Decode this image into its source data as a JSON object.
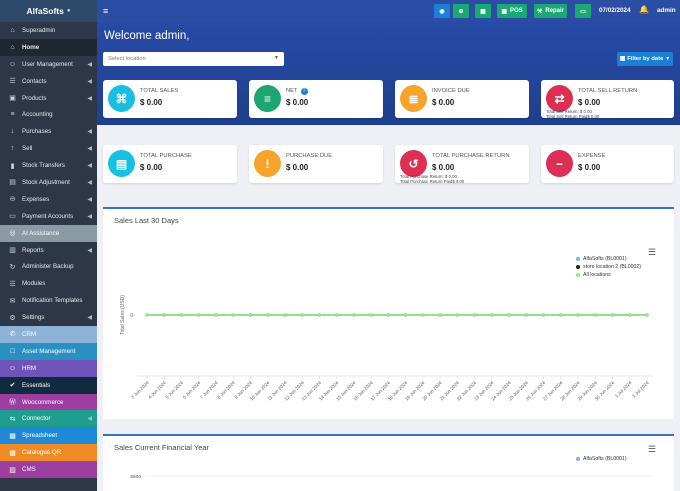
{
  "brand": {
    "name": "AlfaSofts",
    "tag": "●"
  },
  "sidebar": {
    "items": [
      {
        "label": "Superadmin",
        "icon": "home-icon",
        "bg": "",
        "arrow": false,
        "active": false
      },
      {
        "label": "Home",
        "icon": "home-icon",
        "bg": "",
        "arrow": false,
        "active": true
      },
      {
        "label": "User Management",
        "icon": "users-icon",
        "bg": "",
        "arrow": true,
        "active": false
      },
      {
        "label": "Contacts",
        "icon": "address-book-icon",
        "bg": "",
        "arrow": true,
        "active": false
      },
      {
        "label": "Products",
        "icon": "cube-icon",
        "bg": "",
        "arrow": true,
        "active": false
      },
      {
        "label": "Accounting",
        "icon": "accounting-icon",
        "bg": "",
        "arrow": false,
        "active": false
      },
      {
        "label": "Purchases",
        "icon": "download-icon",
        "bg": "",
        "arrow": true,
        "active": false
      },
      {
        "label": "Sell",
        "icon": "upload-icon",
        "bg": "",
        "arrow": true,
        "active": false
      },
      {
        "label": "Stock Transfers",
        "icon": "truck-icon",
        "bg": "",
        "arrow": true,
        "active": false
      },
      {
        "label": "Stock Adjustment",
        "icon": "database-icon",
        "bg": "",
        "arrow": true,
        "active": false
      },
      {
        "label": "Expenses",
        "icon": "minus-circle-icon",
        "bg": "",
        "arrow": true,
        "active": false
      },
      {
        "label": "Payment Accounts",
        "icon": "money-icon",
        "bg": "",
        "arrow": true,
        "active": false
      },
      {
        "label": "AI Assistance",
        "icon": "robot-icon",
        "bg": "#8a9ba6",
        "arrow": false,
        "active": false
      },
      {
        "label": "Reports",
        "icon": "chart-icon",
        "bg": "",
        "arrow": true,
        "active": false
      },
      {
        "label": "Administer Backup",
        "icon": "backup-icon",
        "bg": "",
        "arrow": false,
        "active": false
      },
      {
        "label": "Modules",
        "icon": "plug-icon",
        "bg": "",
        "arrow": false,
        "active": false
      },
      {
        "label": "Notification Templates",
        "icon": "envelope-icon",
        "bg": "",
        "arrow": false,
        "active": false
      },
      {
        "label": "Settings",
        "icon": "gear-icon",
        "bg": "",
        "arrow": true,
        "active": false
      },
      {
        "label": "CRM",
        "icon": "crm-icon",
        "bg": "#8db3d8",
        "arrow": false,
        "active": false
      },
      {
        "label": "Asset Management",
        "icon": "box-icon",
        "bg": "#2a8fc2",
        "arrow": false,
        "active": false
      },
      {
        "label": "HRM",
        "icon": "users-icon",
        "bg": "#6f53b8",
        "arrow": false,
        "active": false
      },
      {
        "label": "Essentials",
        "icon": "check-circle-icon",
        "bg": "#102a3f",
        "arrow": false,
        "active": false
      },
      {
        "label": "Woocommerce",
        "icon": "wordpress-icon",
        "bg": "#9c3d9f",
        "arrow": false,
        "active": false
      },
      {
        "label": "Connector",
        "icon": "connector-icon",
        "bg": "#1f9e8f",
        "arrow": true,
        "active": false
      },
      {
        "label": "Spreadsheet",
        "icon": "sheet-icon",
        "bg": "#1e8ad7",
        "arrow": false,
        "active": false
      },
      {
        "label": "Catalogue QR",
        "icon": "qrcode-icon",
        "bg": "#f08a24",
        "arrow": false,
        "active": false
      },
      {
        "label": "CMS",
        "icon": "cms-icon",
        "bg": "#9c3d9f",
        "arrow": false,
        "active": false
      }
    ]
  },
  "topbar": {
    "menu_icon": "≡",
    "buttons": [
      {
        "label": "",
        "icon": "circle-down-icon",
        "glyph": "◉",
        "color": "#1c7fd6"
      },
      {
        "label": "",
        "icon": "plus-circle-icon",
        "glyph": "⊕",
        "color": "#19a974"
      },
      {
        "label": "",
        "icon": "calculator-icon",
        "glyph": "▦",
        "color": "#19a974"
      },
      {
        "label": "POS",
        "icon": "grid-icon",
        "glyph": "▦",
        "color": "#19a974"
      },
      {
        "label": "Repair",
        "icon": "wrench-icon",
        "glyph": "⚒",
        "color": "#19a974"
      },
      {
        "label": "",
        "icon": "money-icon",
        "glyph": "▭",
        "color": "#19a974"
      }
    ],
    "date": "07/02/2024",
    "user": "admin"
  },
  "header": {
    "welcome": "Welcome admin,",
    "location_placeholder": "Select location",
    "filter_label": "Filter by date"
  },
  "stats_row1": [
    {
      "label": "TOTAL SALES",
      "value": "$ 0.00",
      "color": "#17c0e3",
      "icon": "cart-icon",
      "glyph": "⌘",
      "subs": []
    },
    {
      "label": "NET",
      "value": "$ 0.00",
      "color": "#1ca672",
      "icon": "list-icon",
      "glyph": "≡",
      "subs": [],
      "info": "i"
    },
    {
      "label": "INVOICE DUE",
      "value": "$ 0.00",
      "color": "#f6a42c",
      "icon": "invoice-icon",
      "glyph": "≣",
      "subs": []
    },
    {
      "label": "TOTAL SELL RETURN",
      "value": "$ 0.00",
      "color": "#dc2f53",
      "icon": "exchange-icon",
      "glyph": "⇄",
      "subs": [
        "Total Sell Return: $ 0.00",
        "Total Sell Return Paid$ 0.00"
      ]
    }
  ],
  "stats_row2": [
    {
      "label": "TOTAL PURCHASE",
      "value": "$ 0.00",
      "color": "#17c0e3",
      "icon": "money-icon",
      "glyph": "▤",
      "subs": []
    },
    {
      "label": "PURCHASE DUE",
      "value": "$ 0.00",
      "color": "#f6a42c",
      "icon": "warning-icon",
      "glyph": "!",
      "subs": []
    },
    {
      "label": "TOTAL PURCHASE RETURN",
      "value": "$ 0.00",
      "color": "#dc2f53",
      "icon": "undo-icon",
      "glyph": "↺",
      "subs": [
        "Total Purchase Return: $ 0.00",
        "Total Purchase Return Paid$ 0.00"
      ]
    },
    {
      "label": "EXPENSE",
      "value": "$ 0.00",
      "color": "#dc2f53",
      "icon": "minus-circle-icon",
      "glyph": "−",
      "subs": []
    }
  ],
  "chart1_title": "Sales Last 30 Days",
  "chart2_title": "Sales Current Financial Year",
  "chart_data": [
    {
      "type": "line",
      "title": "",
      "ylabel": "Total Sales (USD)",
      "xlabel": "",
      "categories": [
        "3 Jun 2024",
        "4 Jun 2024",
        "5 Jun 2024",
        "6 Jun 2024",
        "7 Jun 2024",
        "8 Jun 2024",
        "9 Jun 2024",
        "10 Jun 2024",
        "11 Jun 2024",
        "12 Jun 2024",
        "13 Jun 2024",
        "14 Jun 2024",
        "15 Jun 2024",
        "16 Jun 2024",
        "17 Jun 2024",
        "18 Jun 2024",
        "19 Jun 2024",
        "20 Jun 2024",
        "21 Jun 2024",
        "22 Jun 2024",
        "23 Jun 2024",
        "24 Jun 2024",
        "25 Jun 2024",
        "26 Jun 2024",
        "27 Jun 2024",
        "28 Jun 2024",
        "29 Jun 2024",
        "30 Jun 2024",
        "1 Jul 2024",
        "2 Jul 2024"
      ],
      "yticks": [
        "0"
      ],
      "ylim": [
        0,
        0
      ],
      "legend_position": "top-right",
      "series": [
        {
          "name": "AlfaSofts (BL0001)",
          "color": "#7cb5ec",
          "values": [
            0,
            0,
            0,
            0,
            0,
            0,
            0,
            0,
            0,
            0,
            0,
            0,
            0,
            0,
            0,
            0,
            0,
            0,
            0,
            0,
            0,
            0,
            0,
            0,
            0,
            0,
            0,
            0,
            0,
            0
          ]
        },
        {
          "name": "store location 2 (BL0002)",
          "color": "#222222",
          "values": [
            0,
            0,
            0,
            0,
            0,
            0,
            0,
            0,
            0,
            0,
            0,
            0,
            0,
            0,
            0,
            0,
            0,
            0,
            0,
            0,
            0,
            0,
            0,
            0,
            0,
            0,
            0,
            0,
            0,
            0
          ]
        },
        {
          "name": "All locations",
          "color": "#90ed7d",
          "values": [
            0,
            0,
            0,
            0,
            0,
            0,
            0,
            0,
            0,
            0,
            0,
            0,
            0,
            0,
            0,
            0,
            0,
            0,
            0,
            0,
            0,
            0,
            0,
            0,
            0,
            0,
            0,
            0,
            0,
            0
          ]
        }
      ]
    },
    {
      "type": "line",
      "title": "",
      "yticks": [
        "5500"
      ],
      "legend_position": "top-right",
      "series": [
        {
          "name": "AlfaSofts (BL0001)",
          "color": "#7cb5ec",
          "values": []
        }
      ]
    }
  ]
}
